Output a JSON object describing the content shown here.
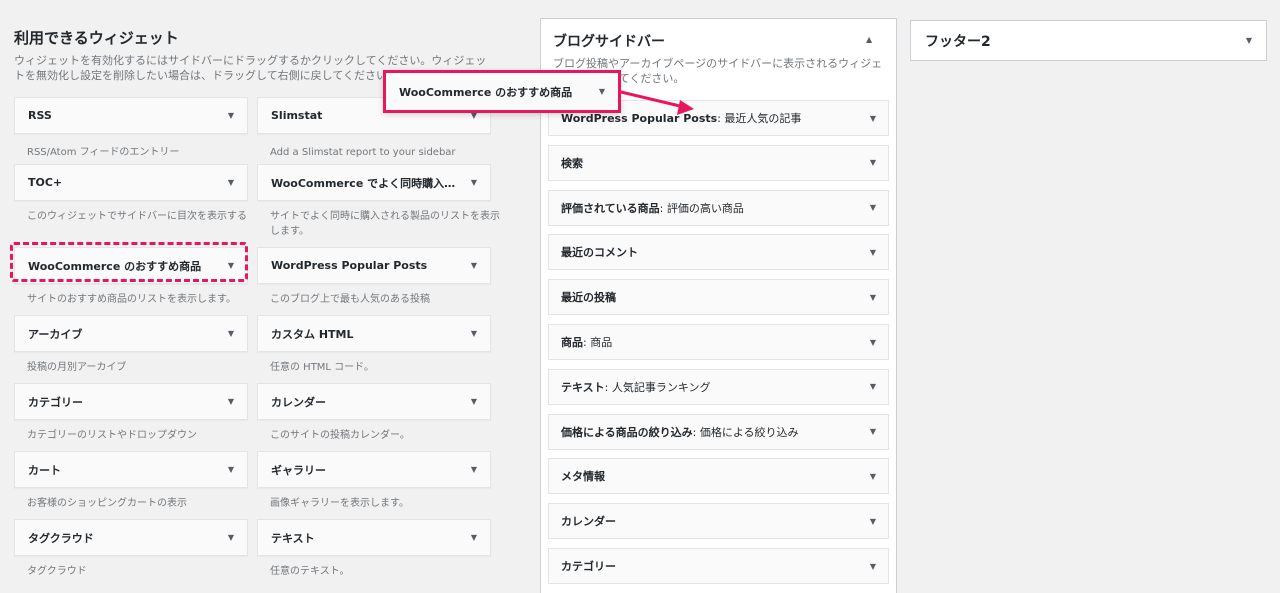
{
  "available": {
    "title": "利用できるウィジェット",
    "description": "ウィジェットを有効化するにはサイドバーにドラッグするかクリックしてください。ウィジェットを無効化し設定を削除したい場合は、ドラッグして右側に戻してください。"
  },
  "widgets": [
    {
      "name": "RSS",
      "desc": "RSS/Atom フィードのエントリー"
    },
    {
      "name": "Slimstat",
      "desc": "Add a Slimstat report to your sidebar"
    },
    {
      "name": "TOC+",
      "desc": "このウィジェットでサイドバーに目次を表示する"
    },
    {
      "name": "WooCommerce でよく同時購入さ…",
      "desc": "サイトでよく同時に購入される製品のリストを表示します。"
    },
    {
      "name": "WooCommerce のおすすめ商品",
      "desc": "サイトのおすすめ商品のリストを表示します。"
    },
    {
      "name": "WordPress Popular Posts",
      "desc": "このブログ上で最も人気のある投稿"
    },
    {
      "name": "アーカイブ",
      "desc": "投稿の月別アーカイブ"
    },
    {
      "name": "カスタム HTML",
      "desc": "任意の HTML コード。"
    },
    {
      "name": "カテゴリー",
      "desc": "カテゴリーのリストやドロップダウン"
    },
    {
      "name": "カレンダー",
      "desc": "このサイトの投稿カレンダー。"
    },
    {
      "name": "カート",
      "desc": "お客様のショッピングカートの表示"
    },
    {
      "name": "ギャラリー",
      "desc": "画像ギャラリーを表示します。"
    },
    {
      "name": "タグクラウド",
      "desc": "タグクラウド"
    },
    {
      "name": "テキスト",
      "desc": "任意のテキスト。"
    }
  ],
  "sidebar": {
    "title": "ブログサイドバー",
    "description": "ブログ投稿やアーカイブページのサイドバーに表示されるウィジェットを追加してください。",
    "items": [
      {
        "name": "WordPress Popular Posts",
        "sub": ": 最近人気の記事"
      },
      {
        "name": "検索",
        "sub": ""
      },
      {
        "name": "評価されている商品",
        "sub": ": 評価の高い商品"
      },
      {
        "name": "最近のコメント",
        "sub": ""
      },
      {
        "name": "最近の投稿",
        "sub": ""
      },
      {
        "name": "商品",
        "sub": ": 商品"
      },
      {
        "name": "テキスト",
        "sub": ": 人気記事ランキング"
      },
      {
        "name": "価格による商品の絞り込み",
        "sub": ": 価格による絞り込み"
      },
      {
        "name": "メタ情報",
        "sub": ""
      },
      {
        "name": "カレンダー",
        "sub": ""
      },
      {
        "name": "カテゴリー",
        "sub": ""
      }
    ]
  },
  "footer": {
    "title": "フッター2"
  },
  "dragging": {
    "name": "WooCommerce のおすすめ商品"
  },
  "glyphs": {
    "down": "▼",
    "up": "▲"
  },
  "colors": {
    "highlight": "#e8175d",
    "panel_border": "#ccd0d4"
  }
}
